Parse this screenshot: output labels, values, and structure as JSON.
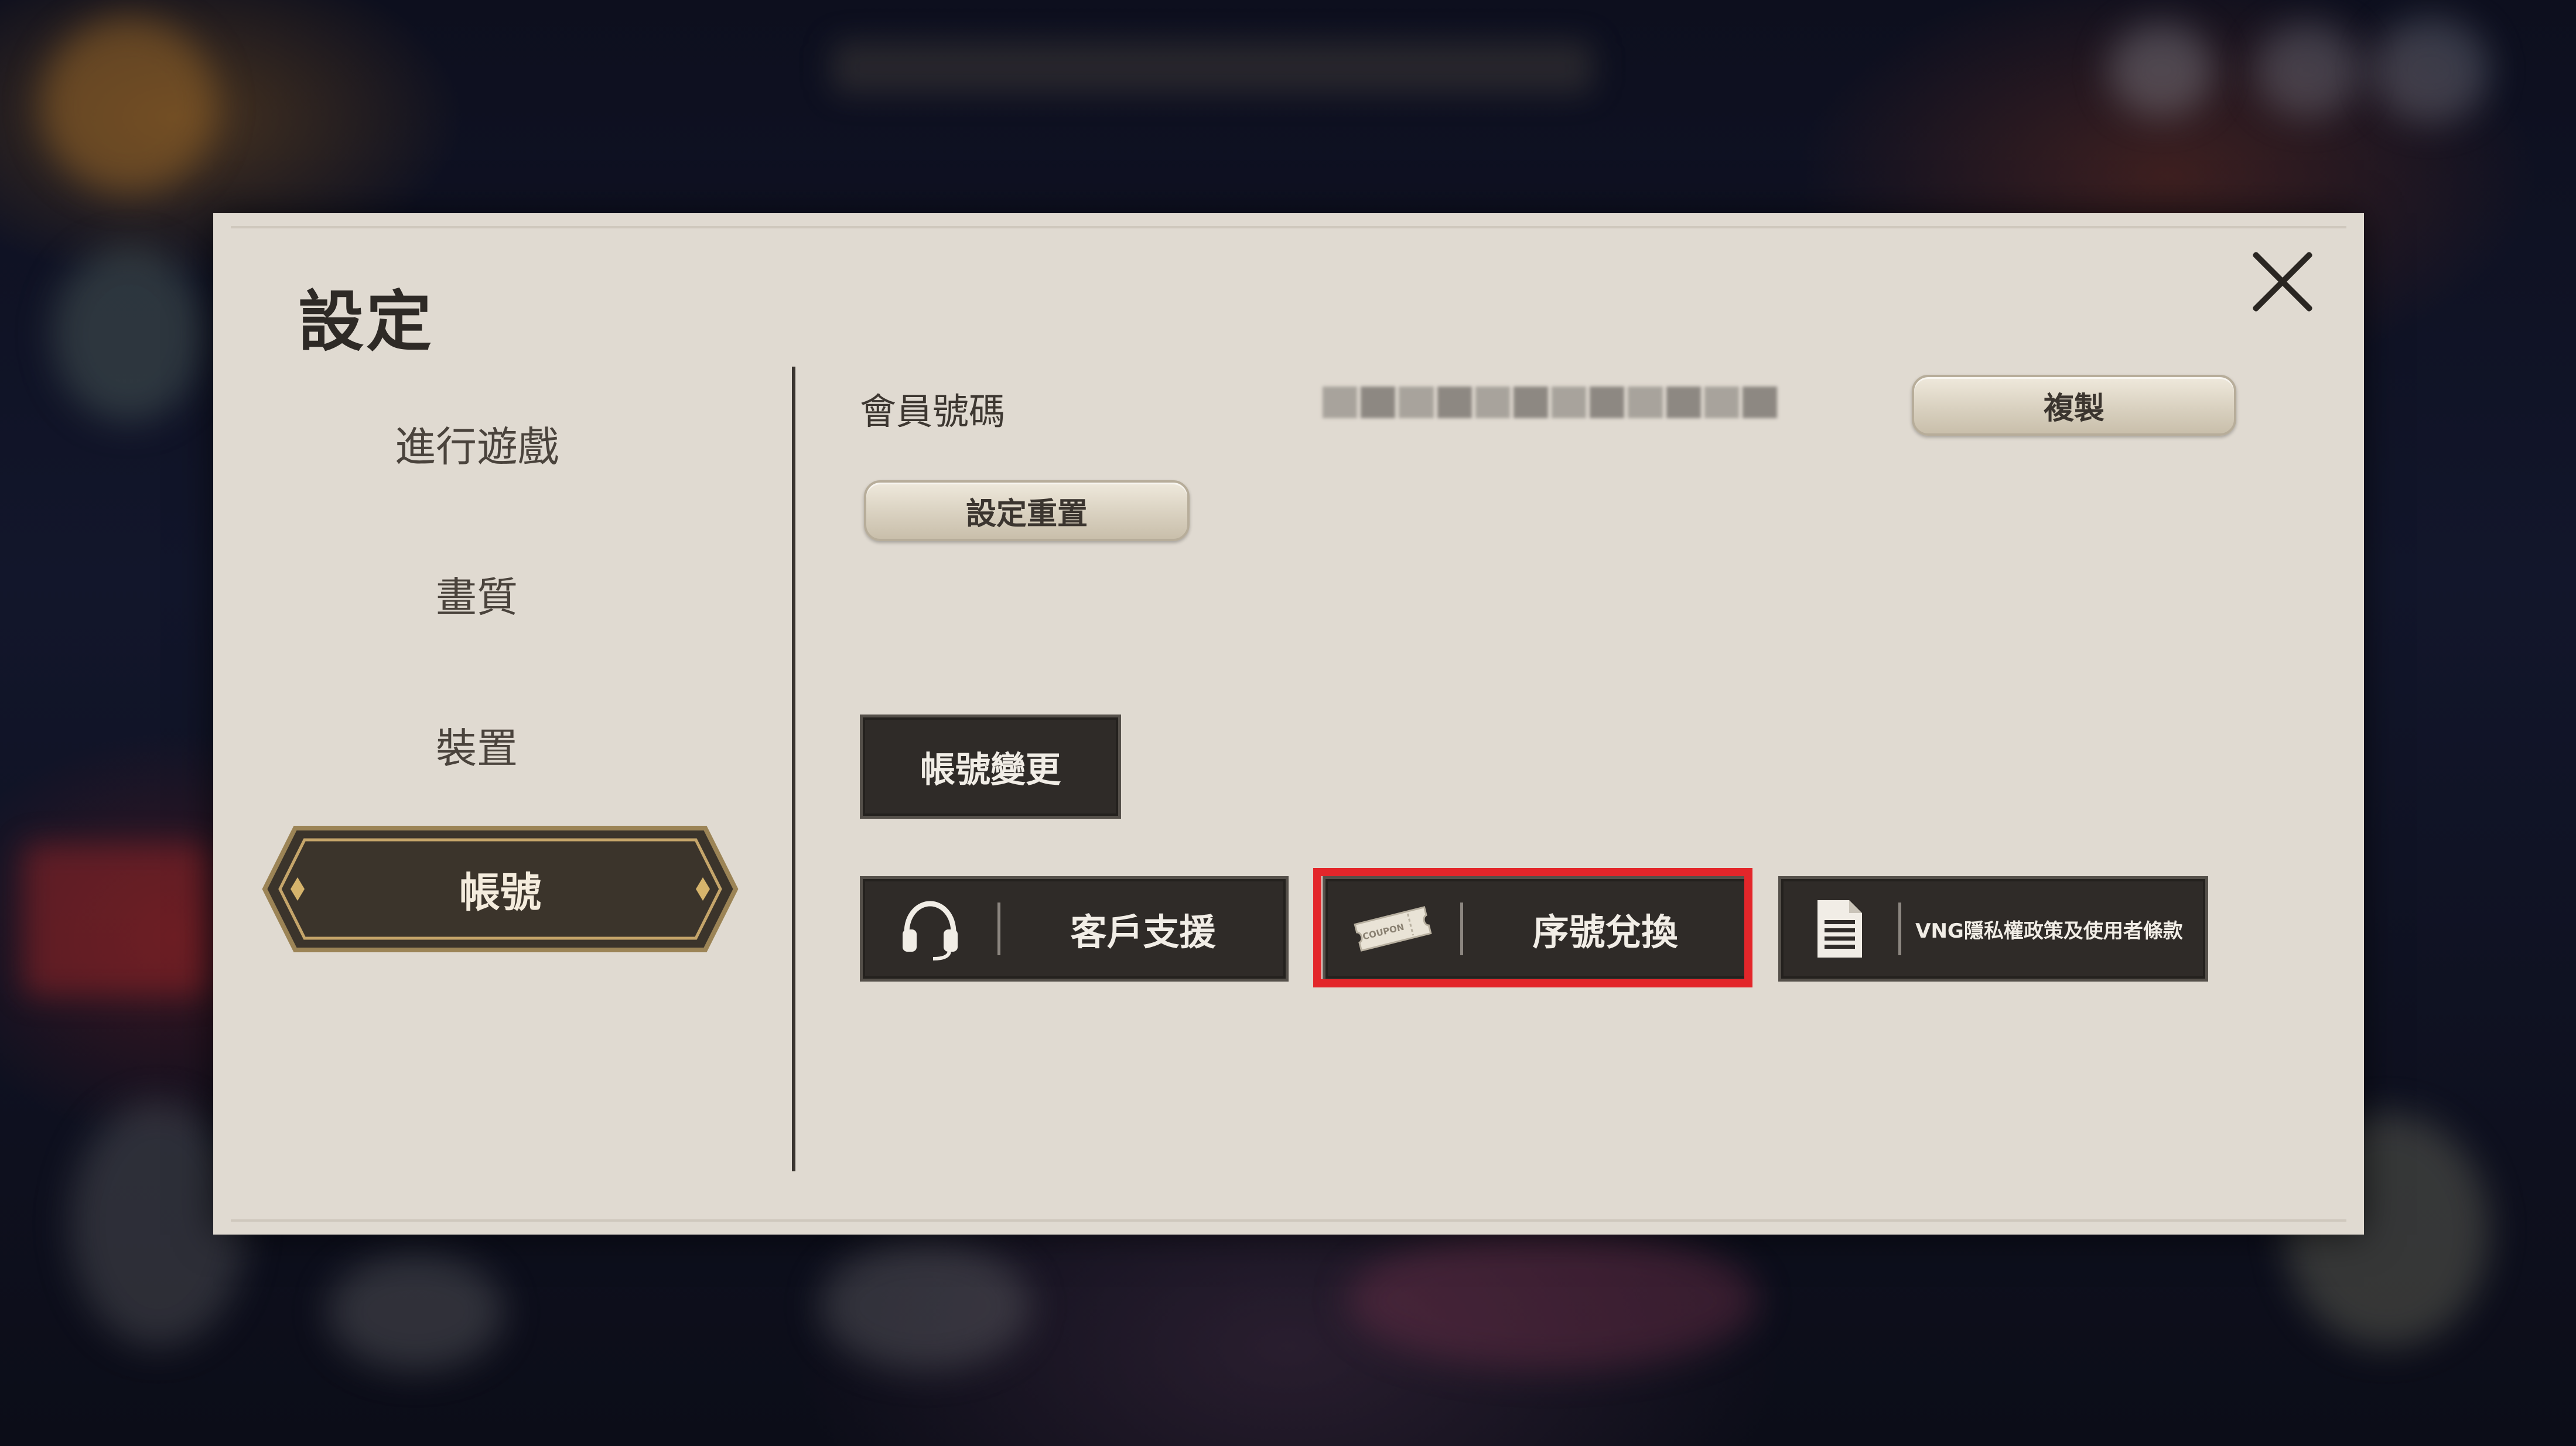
{
  "dialog": {
    "title": "設定",
    "close_icon": "close-icon"
  },
  "sidebar": {
    "items": [
      {
        "label": "進行遊戲",
        "active": false
      },
      {
        "label": "畫質",
        "active": false
      },
      {
        "label": "裝置",
        "active": false
      },
      {
        "label": "帳號",
        "active": true
      }
    ]
  },
  "account": {
    "member_id_label": "會員號碼",
    "member_id_value_blurred": true,
    "copy_label": "複製",
    "reset_label": "設定重置",
    "change_account_label": "帳號變更",
    "support_label": "客戶支援",
    "support_icon": "headset-icon",
    "coupon_label": "序號兌換",
    "coupon_icon": "coupon-ticket-icon",
    "coupon_icon_text": "COUPON",
    "policy_label": "VNG隱私權政策及使用者條款",
    "policy_icon": "document-icon"
  },
  "colors": {
    "dialog_bg": "#e0dad1",
    "dark_button": "#2f2b28",
    "highlight": "#e3262a",
    "active_tab_fill": "#3b342b",
    "active_tab_border": "#c5a56a"
  }
}
